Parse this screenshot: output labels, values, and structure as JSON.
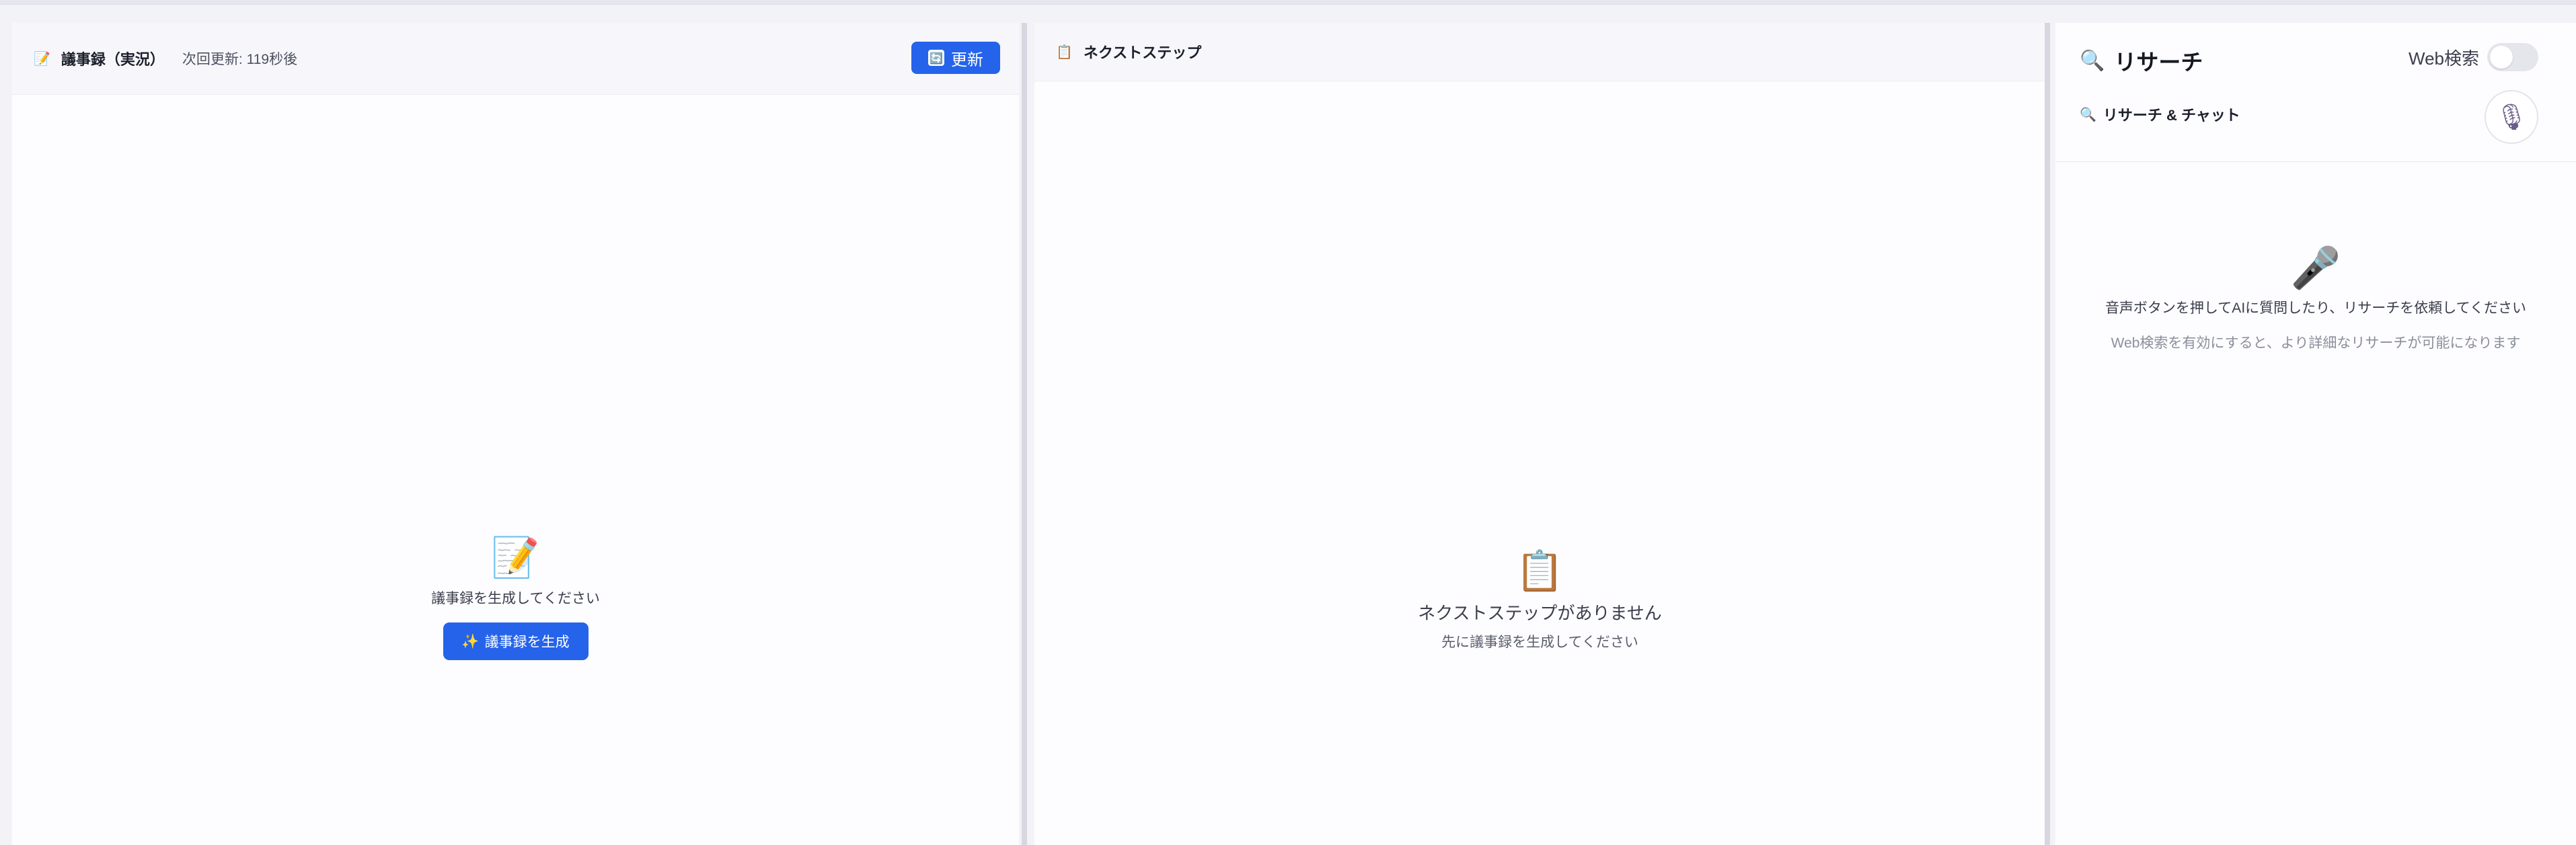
{
  "minutes_panel": {
    "title_icon": "📝",
    "title": "議事録（実況）",
    "next_update": "次回更新: 119秒後",
    "refresh_icon": "🔄",
    "refresh_label": "更新",
    "empty_icon": "📝",
    "empty_text": "議事録を生成してください",
    "generate_icon": "✨",
    "generate_label": "議事録を生成"
  },
  "next_steps_panel": {
    "title_icon": "📋",
    "title": "ネクストステップ",
    "empty_icon": "📋",
    "empty_title": "ネクストステップがありません",
    "empty_sub": "先に議事録を生成してください"
  },
  "research_panel": {
    "title_icon": "🔍",
    "title": "リサーチ",
    "web_search_label": "Web検索",
    "web_search_enabled": false,
    "sub_icon": "🔍",
    "sub_title": "リサーチ & チャット",
    "mic_icon": "🎙",
    "empty_icon": "🎤",
    "empty_text": "音声ボタンを押してAIに質問したり、リサーチを依頼してください",
    "empty_hint": "Web検索を有効にすると、より詳細なリサーチが可能になります"
  },
  "colors": {
    "primary": "#2563eb",
    "panel_bg": "#fdfcfe",
    "divider": "#d7d7e1"
  }
}
